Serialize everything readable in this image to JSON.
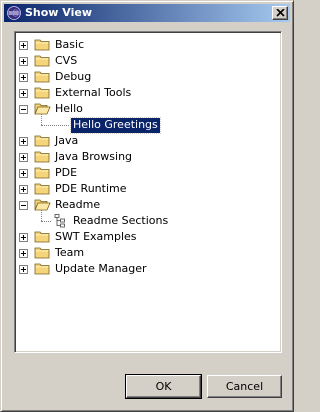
{
  "window": {
    "title": "Show View",
    "close_glyph": "×"
  },
  "tree": {
    "items": [
      {
        "label": "Basic",
        "expanded": false,
        "icon": "folder-icon"
      },
      {
        "label": "CVS",
        "expanded": false,
        "icon": "folder-icon"
      },
      {
        "label": "Debug",
        "expanded": false,
        "icon": "folder-icon"
      },
      {
        "label": "External Tools",
        "expanded": false,
        "icon": "folder-icon"
      },
      {
        "label": "Hello",
        "expanded": true,
        "icon": "folder-open-icon"
      },
      {
        "label": "Hello Greetings",
        "child": true,
        "selected": true,
        "icon": "none"
      },
      {
        "label": "Java",
        "expanded": false,
        "icon": "folder-icon"
      },
      {
        "label": "Java Browsing",
        "expanded": false,
        "icon": "folder-icon"
      },
      {
        "label": "PDE",
        "expanded": false,
        "icon": "folder-icon"
      },
      {
        "label": "PDE Runtime",
        "expanded": false,
        "icon": "folder-icon"
      },
      {
        "label": "Readme",
        "expanded": true,
        "icon": "folder-open-icon"
      },
      {
        "label": "Readme Sections",
        "child": true,
        "selected": false,
        "icon": "readme-sections-icon"
      },
      {
        "label": "SWT Examples",
        "expanded": false,
        "icon": "folder-icon"
      },
      {
        "label": "Team",
        "expanded": false,
        "icon": "folder-icon"
      },
      {
        "label": "Update Manager",
        "expanded": false,
        "icon": "folder-icon"
      }
    ]
  },
  "buttons": {
    "ok_label": "OK",
    "cancel_label": "Cancel"
  },
  "colors": {
    "selection": "#0a246a",
    "titlebar_start": "#0a246a",
    "titlebar_end": "#a6caf0",
    "folder": "#f6d47a"
  }
}
